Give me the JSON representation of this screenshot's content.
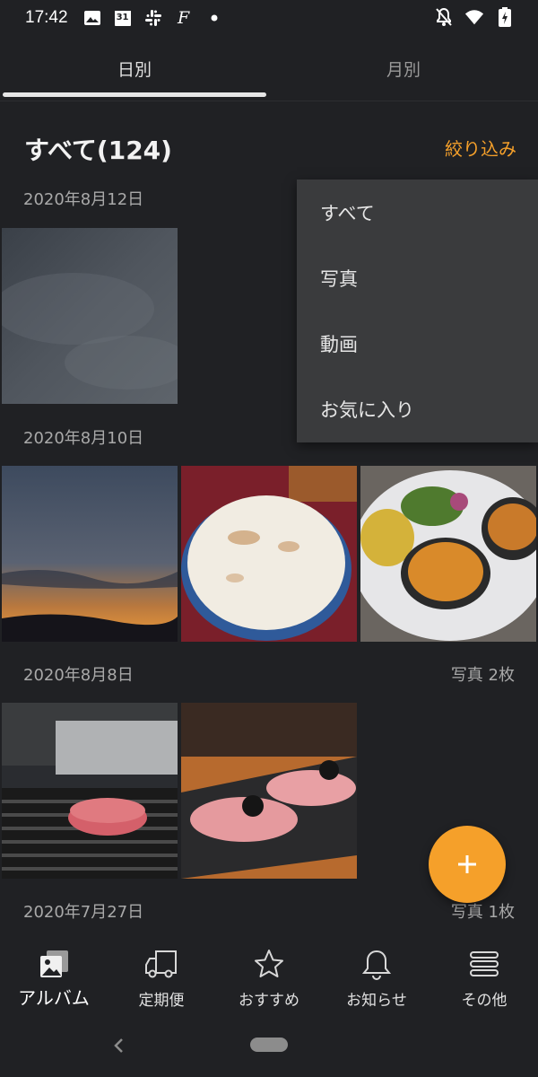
{
  "status_bar": {
    "time": "17:42",
    "calendar_day": "31",
    "app_letter": "F",
    "left_icons": [
      "image-icon",
      "calendar-icon",
      "slack-icon",
      "f-app-icon",
      "dot-icon"
    ],
    "right_icons": [
      "notifications-off-icon",
      "wifi-icon",
      "battery-charging-icon"
    ]
  },
  "tabs": [
    {
      "label": "日別",
      "active": true
    },
    {
      "label": "月別",
      "active": false
    }
  ],
  "header": {
    "title": "すべて(124)",
    "filter_label": "絞り込み"
  },
  "groups": [
    {
      "date": "2020年8月12日",
      "count": ""
    },
    {
      "date": "2020年8月10日",
      "count": ""
    },
    {
      "date": "2020年8月8日",
      "count": "写真 2枚"
    },
    {
      "date": "2020年7月27日",
      "count": "写真 1枚"
    }
  ],
  "filter_menu": {
    "items": [
      "すべて",
      "写真",
      "動画",
      "お気に入り"
    ]
  },
  "fab": {
    "icon": "plus-icon"
  },
  "bottom_nav": [
    {
      "label": "アルバム",
      "icon": "album-icon",
      "active": true
    },
    {
      "label": "定期便",
      "icon": "truck-icon",
      "active": false
    },
    {
      "label": "おすすめ",
      "icon": "star-icon",
      "active": false
    },
    {
      "label": "お知らせ",
      "icon": "bell-icon",
      "active": false
    },
    {
      "label": "その他",
      "icon": "menu-icon",
      "active": false
    }
  ],
  "colors": {
    "background": "#202124",
    "accent": "#f5a02a",
    "menu_background": "#3a3b3d"
  }
}
